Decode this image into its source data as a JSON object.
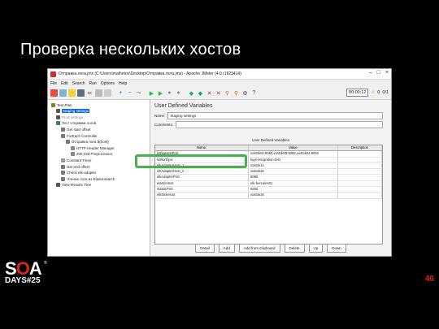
{
  "slide": {
    "title": "Проверка нескольких хостов",
    "page_number": "46",
    "accent_color": "#e1251b"
  },
  "logo": {
    "part1": "S",
    "part2": "O",
    "part3": "A",
    "reg": "®",
    "days": "DAYS#25"
  },
  "window": {
    "title": "Отправка.лога.jmx (C:\\Users\\malhetov\\Desktop\\Отправка.лога.jmx) - Apache JMeter (4.0 r1823414)",
    "menu": [
      "File",
      "Edit",
      "Search",
      "Run",
      "Options",
      "Help"
    ],
    "timer": "00:00:12",
    "warnings": "0",
    "threads": "0/1"
  },
  "tree": [
    {
      "label": "Test Plan",
      "indent": 0,
      "icon_color": "#6b8e23"
    },
    {
      "label": "Staging settings",
      "indent": 1,
      "icon_color": "#555",
      "selected": true
    },
    {
      "label": "Prod settings",
      "indent": 1,
      "icon_color": "#555",
      "dim": true
    },
    {
      "label": "Тест отправки логов",
      "indent": 1,
      "icon_color": "#2e8b57"
    },
    {
      "label": "Get start offset",
      "indent": 2,
      "icon_color": "#777"
    },
    {
      "label": "ForEach Controller",
      "indent": 2,
      "icon_color": "#777"
    },
    {
      "label": "Отправка лога ${host}",
      "indent": 3,
      "icon_color": "#777"
    },
    {
      "label": "HTTP Header Manager",
      "indent": 4,
      "icon_color": "#888"
    },
    {
      "label": "200,222 Preprocessor",
      "indent": 4,
      "icon_color": "#888"
    },
    {
      "label": "Constant Timer",
      "indent": 2,
      "icon_color": "#999"
    },
    {
      "label": "Get end offset",
      "indent": 2,
      "icon_color": "#777"
    },
    {
      "label": "Check elk-adapter",
      "indent": 2,
      "icon_color": "#777"
    },
    {
      "label": "Чтение лога из Elasticsearch",
      "indent": 2,
      "icon_color": "#777"
    },
    {
      "label": "View Results Tree",
      "indent": 1,
      "icon_color": "#555"
    }
  ],
  "panel": {
    "title": "User Defined Variables",
    "name_label": "Name:",
    "name_value": "Staging settings",
    "comments_label": "Comments:",
    "comments_value": "",
    "table_title": "User Defined Variables",
    "columns": [
      "Name:",
      "Value",
      "Description"
    ],
    "rows": [
      {
        "name": "kafkaHostPort",
        "value": "vostok02:9092,vostok03:9092,vostok04:9092",
        "desc": ""
      },
      {
        "name": "kafkaTopic",
        "value": "logs-integration-test",
        "desc": ""
      },
      {
        "name": "elkAdapterHost_1",
        "value": "vostok14",
        "desc": ""
      },
      {
        "name": "elkAdapterHost_2",
        "value": "vostok15",
        "desc": ""
      },
      {
        "name": "elkAdapterPort",
        "value": "8080",
        "desc": ""
      },
      {
        "name": "elasticHost",
        "value": "elk-hercules01",
        "desc": ""
      },
      {
        "name": "elasticPort",
        "value": "9200",
        "desc": ""
      },
      {
        "name": "elkSinkHost",
        "value": "vostok16",
        "desc": ""
      }
    ],
    "buttons": [
      "Detail",
      "Add",
      "Add from Clipboard",
      "Delete",
      "Up",
      "Down"
    ]
  }
}
